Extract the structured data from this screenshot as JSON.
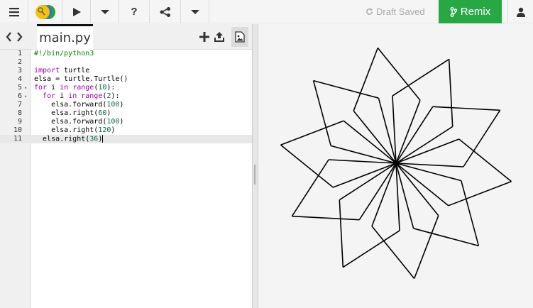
{
  "toolbar": {
    "menu_icon": "hamburger-menu-icon",
    "python_icon": "python-logo-icon",
    "run_icon": "play-icon",
    "run_options_icon": "chevron-down-icon",
    "help_label": "?",
    "share_icon": "share-icon",
    "more_icon": "chevron-down-icon",
    "draft_status": "Draft Saved",
    "remix_label": "Remix",
    "user_icon": "user-icon"
  },
  "tabs": {
    "filename": "main.py",
    "new_file_icon": "plus-icon",
    "upload_icon": "upload-icon",
    "image_icon": "image-icon"
  },
  "editor": {
    "active_line": 11,
    "lines": [
      {
        "n": "1",
        "fold": "",
        "tokens": [
          {
            "t": "#!/bin/python3",
            "c": "shebang"
          }
        ]
      },
      {
        "n": "2",
        "fold": "",
        "tokens": []
      },
      {
        "n": "3",
        "fold": "",
        "tokens": [
          {
            "t": "import",
            "c": "kw"
          },
          {
            "t": " turtle",
            "c": "id"
          }
        ]
      },
      {
        "n": "4",
        "fold": "",
        "tokens": [
          {
            "t": "elsa = turtle.Turtle()",
            "c": "id"
          }
        ]
      },
      {
        "n": "5",
        "fold": "▾",
        "tokens": [
          {
            "t": "for",
            "c": "kw"
          },
          {
            "t": " i ",
            "c": "id"
          },
          {
            "t": "in",
            "c": "kw"
          },
          {
            "t": " ",
            "c": "id"
          },
          {
            "t": "range",
            "c": "kw"
          },
          {
            "t": "(",
            "c": "id"
          },
          {
            "t": "10",
            "c": "num"
          },
          {
            "t": "):",
            "c": "id"
          }
        ]
      },
      {
        "n": "6",
        "fold": "▾",
        "tokens": [
          {
            "t": "  ",
            "c": "id"
          },
          {
            "t": "for",
            "c": "kw"
          },
          {
            "t": " i ",
            "c": "id"
          },
          {
            "t": "in",
            "c": "kw"
          },
          {
            "t": " ",
            "c": "id"
          },
          {
            "t": "range",
            "c": "kw"
          },
          {
            "t": "(",
            "c": "id"
          },
          {
            "t": "2",
            "c": "num"
          },
          {
            "t": "):",
            "c": "id"
          }
        ]
      },
      {
        "n": "7",
        "fold": "",
        "tokens": [
          {
            "t": "    elsa.forward(",
            "c": "id"
          },
          {
            "t": "100",
            "c": "num"
          },
          {
            "t": ")",
            "c": "id"
          }
        ]
      },
      {
        "n": "8",
        "fold": "",
        "tokens": [
          {
            "t": "    elsa.right(",
            "c": "id"
          },
          {
            "t": "60",
            "c": "num"
          },
          {
            "t": ")",
            "c": "id"
          }
        ]
      },
      {
        "n": "9",
        "fold": "",
        "tokens": [
          {
            "t": "    elsa.forward(",
            "c": "id"
          },
          {
            "t": "100",
            "c": "num"
          },
          {
            "t": ")",
            "c": "id"
          }
        ]
      },
      {
        "n": "10",
        "fold": "",
        "tokens": [
          {
            "t": "    elsa.right(",
            "c": "id"
          },
          {
            "t": "120",
            "c": "num"
          },
          {
            "t": ")",
            "c": "id"
          }
        ]
      },
      {
        "n": "11",
        "fold": "",
        "tokens": [
          {
            "t": "  elsa.right(",
            "c": "id"
          },
          {
            "t": "36",
            "c": "num"
          },
          {
            "t": ")",
            "c": "id"
          }
        ]
      }
    ]
  },
  "turtle": {
    "repeat_outer": 10,
    "repeat_inner": 2,
    "forward": 100,
    "turn_a": 60,
    "turn_b": 120,
    "turn_outer": 36,
    "pen_color": "#000000"
  },
  "colors": {
    "remix_green": "#27a844",
    "keyword": "#9900aa",
    "number": "#116644",
    "shebang": "#008800"
  }
}
